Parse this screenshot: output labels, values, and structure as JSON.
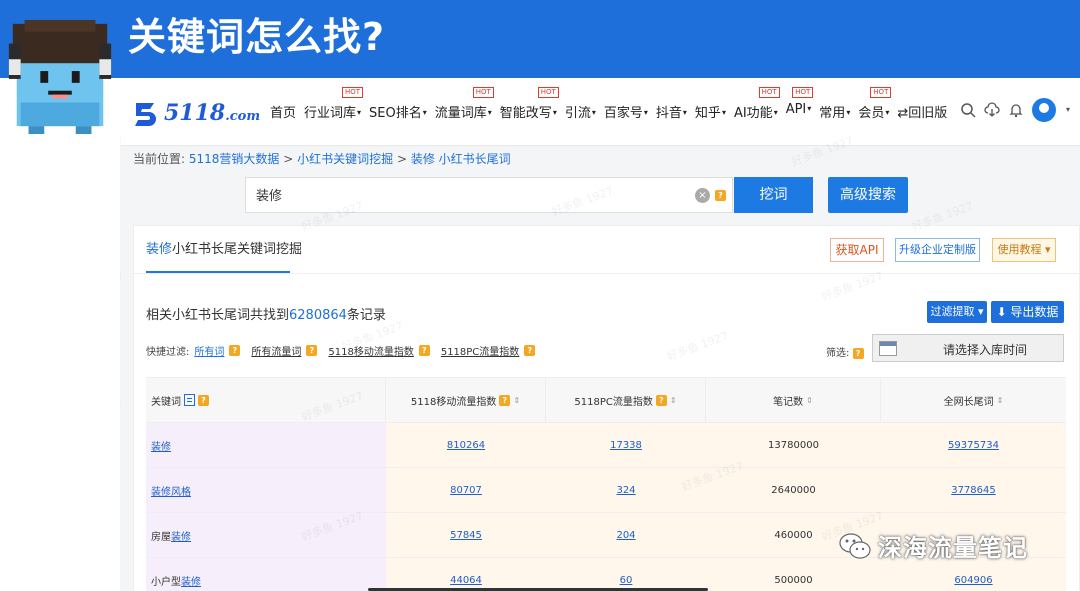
{
  "banner": {
    "title": "关键词怎么找?"
  },
  "nav": {
    "logo": {
      "brand": "5118",
      "suffix": ".com"
    },
    "menu": [
      {
        "label": "首页",
        "caret": "",
        "hot": ""
      },
      {
        "label": "行业词库",
        "caret": "▾",
        "hot": "HOT"
      },
      {
        "label": "SEO排名",
        "caret": "▾",
        "hot": ""
      },
      {
        "label": "流量词库",
        "caret": "▾",
        "hot": "HOT"
      },
      {
        "label": "智能改写",
        "caret": "▾",
        "hot": "HOT"
      },
      {
        "label": "引流",
        "caret": "▾",
        "hot": ""
      },
      {
        "label": "百家号",
        "caret": "▾",
        "hot": ""
      },
      {
        "label": "抖音",
        "caret": "▾",
        "hot": ""
      },
      {
        "label": "知乎",
        "caret": "▾",
        "hot": ""
      },
      {
        "label": "AI功能",
        "caret": "▾",
        "hot": "HOT"
      },
      {
        "label": "API",
        "caret": "▾",
        "hot": "HOT"
      },
      {
        "label": "常用",
        "caret": "▾",
        "hot": ""
      },
      {
        "label": "会员",
        "caret": "▾",
        "hot": "HOT"
      },
      {
        "label": "⇄回旧版",
        "caret": "",
        "hot": ""
      }
    ]
  },
  "breadcrumb": {
    "prefix": "当前位置:",
    "items": [
      "5118营销大数据",
      "小红书关键词挖掘",
      "装修 小红书长尾词"
    ],
    "separator": " > "
  },
  "search": {
    "value": "装修",
    "clear": "×",
    "help": "?",
    "dig_label": "挖词",
    "advanced_label": "高级搜索"
  },
  "panel": {
    "tab_keyword": "装修",
    "tab_rest": "小红书长尾关键词挖掘",
    "api_label": "获取API",
    "custom_label": "升级企业定制版",
    "tutorial_label": "使用教程 ▾",
    "result_prefix": "相关小红书长尾词共找到",
    "result_count": "6280864",
    "result_suffix": "条记录",
    "filter_label": "过滤提取 ▾",
    "export_label": "⬇ 导出数据",
    "quick_filter_label": "快捷过滤:",
    "quick_filters": [
      "所有词",
      "所有流量词",
      "5118移动流量指数",
      "5118PC流量指数"
    ],
    "screen_label": "筛选:",
    "date_placeholder": "请选择入库时间"
  },
  "table": {
    "headers": [
      "关键词",
      "5118移动流量指数",
      "5118PC流量指数",
      "笔记数",
      "全网长尾词"
    ],
    "rows": [
      {
        "kw_pre": "",
        "kw_link": "装修",
        "mobile": "810264",
        "pc": "17338",
        "notes": "13780000",
        "longtail": "59375734"
      },
      {
        "kw_pre": "",
        "kw_link": "装修风格",
        "mobile": "80707",
        "pc": "324",
        "notes": "2640000",
        "longtail": "3778645"
      },
      {
        "kw_pre": "房屋",
        "kw_link": "装修",
        "mobile": "57845",
        "pc": "204",
        "notes": "460000",
        "longtail": ""
      },
      {
        "kw_pre": "小户型",
        "kw_link": "装修",
        "mobile": "44064",
        "pc": "60",
        "notes": "500000",
        "longtail": "604906"
      }
    ]
  },
  "watermark": {
    "text": "好多鱼 1927"
  },
  "account_brand": {
    "text": "深海流量笔记"
  },
  "colors": {
    "brand_blue": "#1e6fd9",
    "banner_blue": "#1e6fd9",
    "hot_red": "#e03b2c",
    "help_orange": "#f5a623"
  },
  "icons": [
    "search-icon",
    "cloud-download-icon",
    "bell-icon",
    "user-avatar-icon",
    "clear-icon",
    "calendar-icon",
    "list-icon",
    "sort-icon",
    "wechat-icon"
  ]
}
